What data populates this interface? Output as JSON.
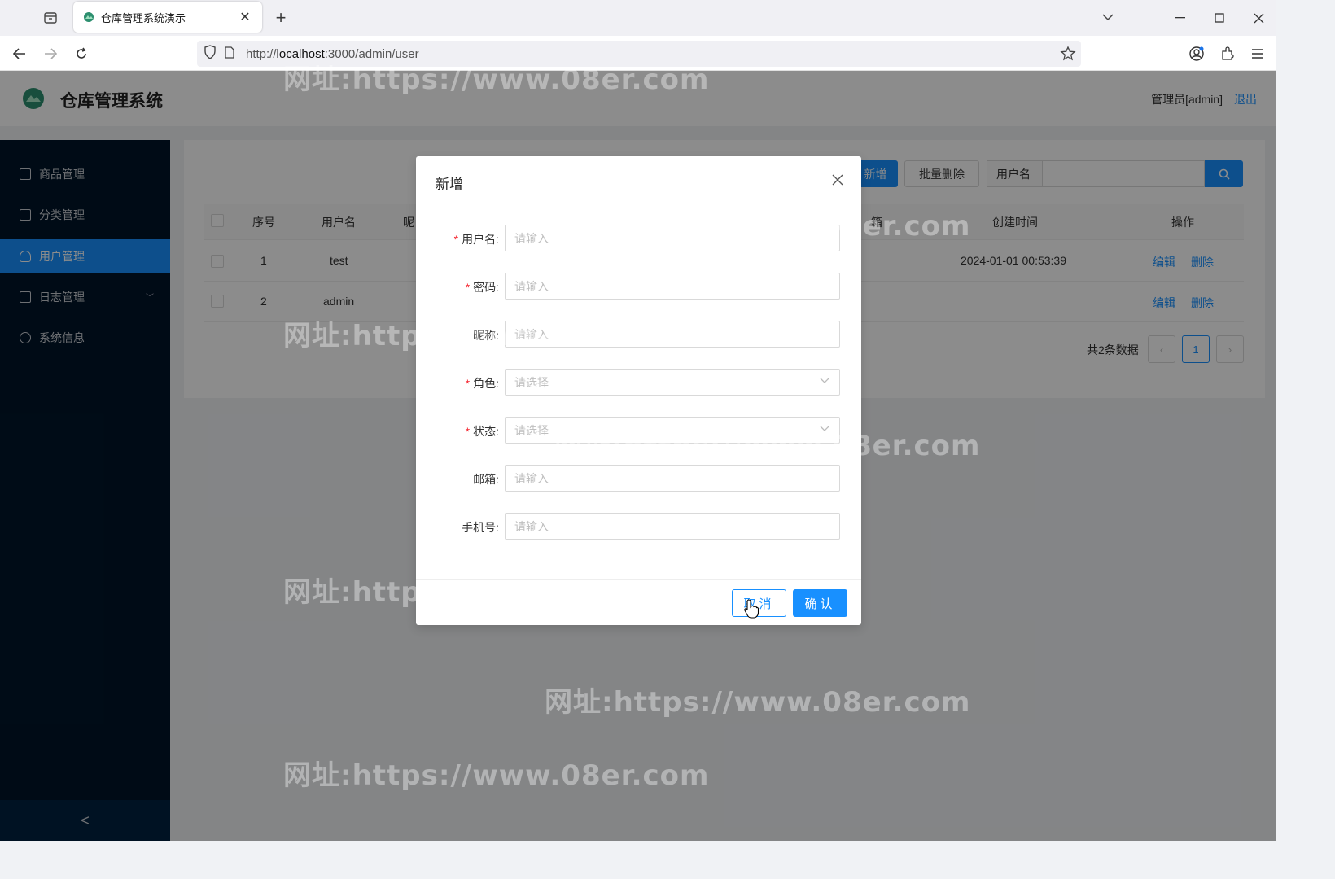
{
  "browser": {
    "tab_title": "仓库管理系统演示",
    "url_prefix": "http://",
    "url_host": "localhost",
    "url_path": ":3000/admin/user"
  },
  "header": {
    "brand": "仓库管理系统",
    "user": "管理员[admin]",
    "logout": "退出"
  },
  "sidebar": {
    "items": [
      {
        "label": "商品管理"
      },
      {
        "label": "分类管理"
      },
      {
        "label": "用户管理",
        "active": true
      },
      {
        "label": "日志管理"
      },
      {
        "label": "系统信息"
      }
    ],
    "collapse": "<"
  },
  "toolbar": {
    "add": "新增",
    "batch_delete": "批量删除",
    "search_field": "用户名"
  },
  "table": {
    "headers": {
      "index": "序号",
      "username": "用户名",
      "nickname": "昵",
      "email_part": "箱",
      "created": "创建时间",
      "actions": "操作"
    },
    "rows": [
      {
        "index": "1",
        "username": "test",
        "created": "2024-01-01 00:53:39",
        "edit": "编辑",
        "delete": "删除"
      },
      {
        "index": "2",
        "username": "admin",
        "created": "",
        "edit": "编辑",
        "delete": "删除"
      }
    ],
    "total": "共2条数据",
    "page": "1"
  },
  "modal": {
    "title": "新增",
    "fields": [
      {
        "label": "用户名",
        "required": true,
        "placeholder": "请输入"
      },
      {
        "label": "密码",
        "required": true,
        "placeholder": "请输入"
      },
      {
        "label": "昵称",
        "required": false,
        "placeholder": "请输入"
      },
      {
        "label": "角色",
        "required": true,
        "placeholder": "请选择"
      },
      {
        "label": "状态",
        "required": true,
        "placeholder": "请选择"
      },
      {
        "label": "邮箱",
        "required": false,
        "placeholder": "请输入"
      },
      {
        "label": "手机号",
        "required": false,
        "placeholder": "请输入"
      }
    ],
    "cancel": "取消",
    "confirm": "确认"
  },
  "watermark": "网址:https://www.08er.com",
  "colors": {
    "primary": "#1890ff",
    "sidebar": "#001529",
    "required": "#f5222d"
  }
}
